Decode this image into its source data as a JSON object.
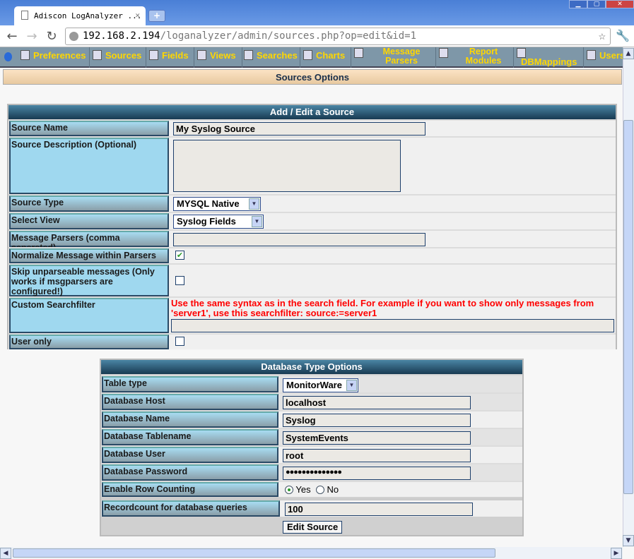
{
  "browser": {
    "tab_title": "Adiscon LogAnalyzer ...",
    "url_host": "192.168.2.194",
    "url_path": "/loganalyzer/admin/sources.php?op=edit&id=1"
  },
  "nav": [
    {
      "label": "Preferences",
      "icon": "preferences-icon"
    },
    {
      "label": "Sources",
      "icon": "sources-icon"
    },
    {
      "label": "Fields",
      "icon": "fields-icon"
    },
    {
      "label": "Views",
      "icon": "views-icon"
    },
    {
      "label": "Searches",
      "icon": "searches-icon"
    },
    {
      "label": "Charts",
      "icon": "charts-icon"
    },
    {
      "label": "Message Parsers",
      "icon": "gear-icon"
    },
    {
      "label": "Report Modules",
      "icon": "report-icon"
    },
    {
      "label": "DBMappings",
      "icon": "gear-icon"
    },
    {
      "label": "Users",
      "icon": "user-icon"
    }
  ],
  "section_title": "Sources Options",
  "source": {
    "title": "Add / Edit a Source",
    "name_label": "Source Name",
    "name_value": "My Syslog Source",
    "desc_label": "Source Description (Optional)",
    "desc_value": "",
    "type_label": "Source Type",
    "type_value": "MYSQL Native",
    "view_label": "Select View",
    "view_value": "Syslog Fields",
    "parsers_label": "Message Parsers (comma seperated)",
    "parsers_value": "",
    "normalize_label": "Normalize Message within Parsers",
    "normalize_checked": true,
    "skip_label": "Skip unparseable messages (Only works if msgparsers are configured!)",
    "skip_checked": false,
    "filter_label": "Custom Searchfilter",
    "filter_hint": "Use the same syntax as in the search field. For example if you want to show only messages from 'server1', use this searchfilter: source:=server1",
    "filter_value": "",
    "useronly_label": "User only",
    "useronly_checked": false
  },
  "db": {
    "title": "Database Type Options",
    "tabletype_label": "Table type",
    "tabletype_value": "MonitorWare",
    "host_label": "Database Host",
    "host_value": "localhost",
    "name_label": "Database Name",
    "name_value": "Syslog",
    "tablename_label": "Database Tablename",
    "tablename_value": "SystemEvents",
    "user_label": "Database User",
    "user_value": "root",
    "password_label": "Database Password",
    "password_value": "●●●●●●●●●●●●●●",
    "rowcount_label": "Enable Row Counting",
    "rowcount_yes": "Yes",
    "rowcount_no": "No",
    "rowcount_selected": "Yes",
    "recordcount_label": "Recordcount for database queries",
    "recordcount_value": "100",
    "submit_label": "Edit Source"
  }
}
